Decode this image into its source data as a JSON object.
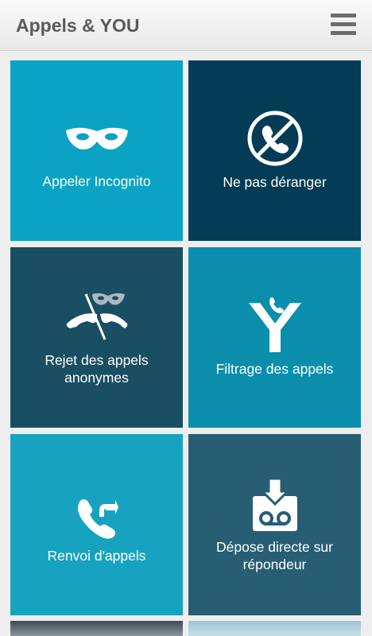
{
  "header": {
    "title": "Appels & YOU"
  },
  "tiles": [
    {
      "label": "Appeler Incognito",
      "icon": "mask-icon",
      "color": "#0ba3c3"
    },
    {
      "label": "Ne pas déranger",
      "icon": "no-call-icon",
      "color": "#043c55"
    },
    {
      "label": "Rejet des appels\nanonymes",
      "icon": "reject-anonymous-icon",
      "color": "#1a4e63"
    },
    {
      "label": "Filtrage des appels",
      "icon": "call-filter-icon",
      "color": "#0b8eac"
    },
    {
      "label": "Renvoi d'appels",
      "icon": "call-forward-icon",
      "color": "#17a3c0"
    },
    {
      "label": "Dépose directe sur\nrépondeur",
      "icon": "voicemail-drop-icon",
      "color": "#275e73"
    }
  ]
}
